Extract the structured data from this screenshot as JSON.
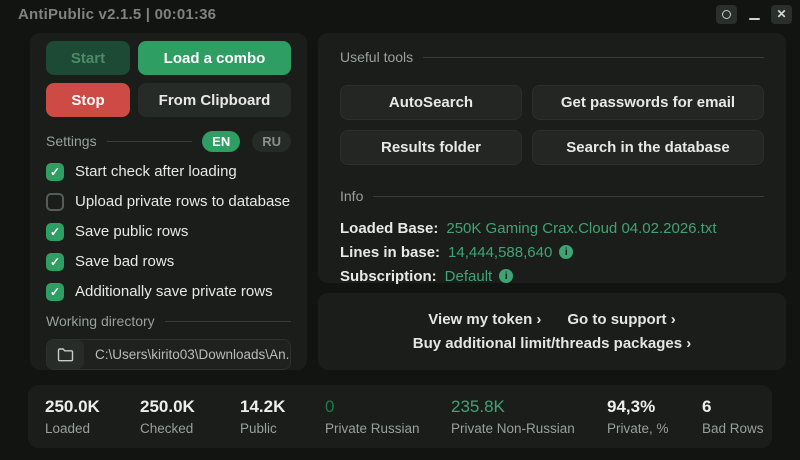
{
  "titlebar": {
    "title": "AntiPublic v2.1.5 | 00:01:36"
  },
  "icons": {
    "close": "✕",
    "check": "✓",
    "info": "i"
  },
  "left_panel": {
    "buttons": {
      "start": "Start",
      "load_combo": "Load a combo",
      "stop": "Stop",
      "from_clipboard": "From Clipboard"
    },
    "settings": {
      "label": "Settings",
      "lang_en": "EN",
      "lang_ru": "RU",
      "checkboxes": [
        {
          "label": "Start check after loading",
          "checked": true
        },
        {
          "label": "Upload private rows to database",
          "checked": false
        },
        {
          "label": "Save public rows",
          "checked": true
        },
        {
          "label": "Save bad rows",
          "checked": true
        },
        {
          "label": "Additionally save private rows",
          "checked": true
        }
      ]
    },
    "working_directory": {
      "label": "Working directory",
      "path": "C:\\Users\\kirito03\\Downloads\\An..."
    }
  },
  "tools": {
    "label": "Useful tools",
    "buttons": [
      "AutoSearch",
      "Get passwords for email",
      "Results folder",
      "Search in the database"
    ]
  },
  "info": {
    "label": "Info",
    "rows": [
      {
        "label": "Loaded Base:",
        "value": "250K Gaming Crax.Cloud 04.02.2026.txt"
      },
      {
        "label": "Lines in base:",
        "value": "14,444,588,640"
      },
      {
        "label": "Subscription:",
        "value": "Default"
      }
    ]
  },
  "links": {
    "view_token": "View my token ›",
    "support": "Go to support ›",
    "buy": "Buy additional limit/threads packages ›"
  },
  "stats": [
    {
      "value": "250.0K",
      "label": "Loaded"
    },
    {
      "value": "250.0K",
      "label": "Checked"
    },
    {
      "value": "14.2K",
      "label": "Public"
    },
    {
      "value": "0",
      "label": "Private Russian"
    },
    {
      "value": "235.8K",
      "label": "Private Non-Russian"
    },
    {
      "value": "94,3%",
      "label": "Private, %"
    },
    {
      "value": "6",
      "label": "Bad Rows"
    }
  ],
  "colors": {
    "accent_green": "#2f9e63",
    "value_green": "#3fa474",
    "dark_green_value": "#1f7a4c",
    "stop_red": "#cd4b44",
    "card_bg": "#1a1d1a",
    "window_bg": "#121412"
  }
}
